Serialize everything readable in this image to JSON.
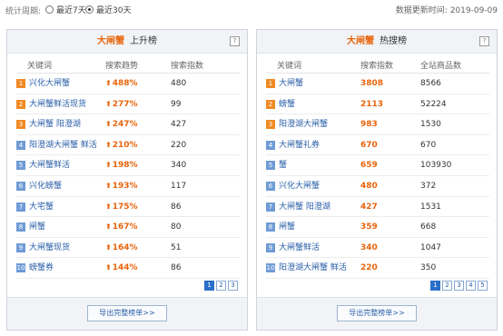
{
  "topbar": {
    "period_label": "统计周期:",
    "option_7": "最近7天",
    "option_30": "最近30天",
    "update_time": "数据更新时间: 2019-09-09"
  },
  "left_panel": {
    "keyword": "大闸蟹",
    "subtitle": "上升榜",
    "help": "?",
    "headers": [
      "关键词",
      "搜索趋势",
      "搜索指数"
    ],
    "rows": [
      {
        "rank": "1",
        "keyword": "兴化大闸蟹",
        "trend": "488%",
        "index": "480"
      },
      {
        "rank": "2",
        "keyword": "大闸蟹鲜活现货",
        "trend": "277%",
        "index": "99"
      },
      {
        "rank": "3",
        "keyword": "大闸蟹 阳澄湖",
        "trend": "247%",
        "index": "427"
      },
      {
        "rank": "4",
        "keyword": "阳澄湖大闸蟹 鲜活",
        "trend": "210%",
        "index": "220"
      },
      {
        "rank": "5",
        "keyword": "大闸蟹鲜活",
        "trend": "198%",
        "index": "340"
      },
      {
        "rank": "6",
        "keyword": "兴化螃蟹",
        "trend": "193%",
        "index": "117"
      },
      {
        "rank": "7",
        "keyword": "大宅蟹",
        "trend": "175%",
        "index": "86"
      },
      {
        "rank": "8",
        "keyword": "闸蟹",
        "trend": "167%",
        "index": "80"
      },
      {
        "rank": "9",
        "keyword": "大闸蟹现货",
        "trend": "164%",
        "index": "51"
      },
      {
        "rank": "10",
        "keyword": "螃蟹券",
        "trend": "144%",
        "index": "86"
      }
    ],
    "pages": [
      "1",
      "2",
      "3"
    ],
    "export": "导出完整榜单>>"
  },
  "right_panel": {
    "keyword": "大闸蟹",
    "subtitle": "热搜榜",
    "help": "?",
    "headers": [
      "关键词",
      "搜索指数",
      "全站商品数"
    ],
    "rows": [
      {
        "rank": "1",
        "keyword": "大闸蟹",
        "index": "3808",
        "count": "8566"
      },
      {
        "rank": "2",
        "keyword": "螃蟹",
        "index": "2113",
        "count": "52224"
      },
      {
        "rank": "3",
        "keyword": "阳澄湖大闸蟹",
        "index": "983",
        "count": "1530"
      },
      {
        "rank": "4",
        "keyword": "大闸蟹礼券",
        "index": "670",
        "count": "670"
      },
      {
        "rank": "5",
        "keyword": "蟹",
        "index": "659",
        "count": "103930"
      },
      {
        "rank": "6",
        "keyword": "兴化大闸蟹",
        "index": "480",
        "count": "372"
      },
      {
        "rank": "7",
        "keyword": "大闸蟹 阳澄湖",
        "index": "427",
        "count": "1531"
      },
      {
        "rank": "8",
        "keyword": "闸蟹",
        "index": "359",
        "count": "668"
      },
      {
        "rank": "9",
        "keyword": "大闸蟹鲜活",
        "index": "340",
        "count": "1047"
      },
      {
        "rank": "10",
        "keyword": "阳澄湖大闸蟹 鲜活",
        "index": "220",
        "count": "350"
      }
    ],
    "pages": [
      "1",
      "2",
      "3",
      "4",
      "5"
    ],
    "export": "导出完整榜单>>"
  }
}
